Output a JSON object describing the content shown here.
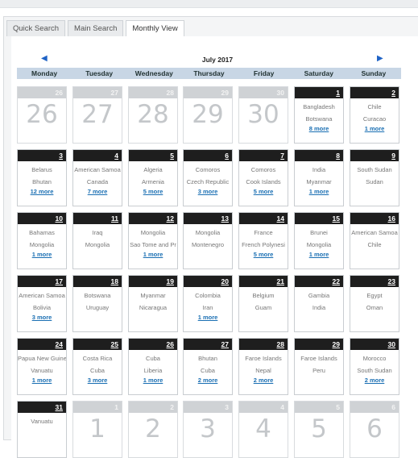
{
  "tabs": [
    {
      "label": "Quick Search",
      "active": false
    },
    {
      "label": "Main Search",
      "active": false
    },
    {
      "label": "Monthly View",
      "active": true
    }
  ],
  "calendar": {
    "month_title": "July 2017",
    "prev_icon": "triangle-left-icon",
    "next_icon": "triangle-right-icon",
    "weekdays": [
      "Monday",
      "Tuesday",
      "Wednesday",
      "Thursday",
      "Friday",
      "Saturday",
      "Sunday"
    ],
    "weeks": [
      [
        {
          "day": "26",
          "other": true
        },
        {
          "day": "27",
          "other": true
        },
        {
          "day": "28",
          "other": true
        },
        {
          "day": "29",
          "other": true
        },
        {
          "day": "30",
          "other": true
        },
        {
          "day": "1",
          "events": [
            "Bangladesh",
            "Botswana"
          ],
          "more": "8 more"
        },
        {
          "day": "2",
          "events": [
            "Chile",
            "Curacao"
          ],
          "more": "1 more"
        }
      ],
      [
        {
          "day": "3",
          "events": [
            "Belarus",
            "Bhutan"
          ],
          "more": "12 more"
        },
        {
          "day": "4",
          "events": [
            "American Samoa",
            "Canada"
          ],
          "more": "7 more"
        },
        {
          "day": "5",
          "events": [
            "Algeria",
            "Armenia"
          ],
          "more": "5 more"
        },
        {
          "day": "6",
          "events": [
            "Comoros",
            "Czech Republic"
          ],
          "more": "3 more"
        },
        {
          "day": "7",
          "events": [
            "Comoros",
            "Cook Islands"
          ],
          "more": "5 more"
        },
        {
          "day": "8",
          "events": [
            "India",
            "Myanmar"
          ],
          "more": "1 more"
        },
        {
          "day": "9",
          "events": [
            "South Sudan",
            "Sudan"
          ],
          "more": ""
        }
      ],
      [
        {
          "day": "10",
          "events": [
            "Bahamas",
            "Mongolia"
          ],
          "more": "1 more"
        },
        {
          "day": "11",
          "events": [
            "Iraq",
            "Mongolia"
          ],
          "more": ""
        },
        {
          "day": "12",
          "events": [
            "Mongolia",
            "Sao Tome and Pr"
          ],
          "more": "1 more"
        },
        {
          "day": "13",
          "events": [
            "Mongolia",
            "Montenegro"
          ],
          "more": ""
        },
        {
          "day": "14",
          "events": [
            "France",
            "French Polynesi"
          ],
          "more": "5 more"
        },
        {
          "day": "15",
          "events": [
            "Brunei",
            "Mongolia"
          ],
          "more": "1 more"
        },
        {
          "day": "16",
          "events": [
            "American Samoa",
            "Chile"
          ],
          "more": ""
        }
      ],
      [
        {
          "day": "17",
          "events": [
            "American Samoa",
            "Bolivia"
          ],
          "more": "3 more"
        },
        {
          "day": "18",
          "events": [
            "Botswana",
            "Uruguay"
          ],
          "more": ""
        },
        {
          "day": "19",
          "events": [
            "Myanmar",
            "Nicaragua"
          ],
          "more": ""
        },
        {
          "day": "20",
          "events": [
            "Colombia",
            "Iran"
          ],
          "more": "1 more"
        },
        {
          "day": "21",
          "events": [
            "Belgium",
            "Guam"
          ],
          "more": ""
        },
        {
          "day": "22",
          "events": [
            "Gambia",
            "India"
          ],
          "more": ""
        },
        {
          "day": "23",
          "events": [
            "Egypt",
            "Oman"
          ],
          "more": ""
        }
      ],
      [
        {
          "day": "24",
          "events": [
            "Papua New Guine",
            "Vanuatu"
          ],
          "more": "1 more"
        },
        {
          "day": "25",
          "events": [
            "Costa Rica",
            "Cuba"
          ],
          "more": "3 more"
        },
        {
          "day": "26",
          "events": [
            "Cuba",
            "Liberia"
          ],
          "more": "1 more"
        },
        {
          "day": "27",
          "events": [
            "Bhutan",
            "Cuba"
          ],
          "more": "2 more"
        },
        {
          "day": "28",
          "events": [
            "Faroe Islands",
            "Nepal"
          ],
          "more": "2 more"
        },
        {
          "day": "29",
          "events": [
            "Faroe Islands",
            "Peru"
          ],
          "more": ""
        },
        {
          "day": "30",
          "events": [
            "Morocco",
            "South Sudan"
          ],
          "more": "2 more"
        }
      ],
      [
        {
          "day": "31",
          "events": [
            "Vanuatu"
          ],
          "more": ""
        },
        {
          "day": "1",
          "other": true
        },
        {
          "day": "2",
          "other": true
        },
        {
          "day": "3",
          "other": true
        },
        {
          "day": "4",
          "other": true
        },
        {
          "day": "5",
          "other": true
        },
        {
          "day": "6",
          "other": true
        }
      ]
    ]
  }
}
